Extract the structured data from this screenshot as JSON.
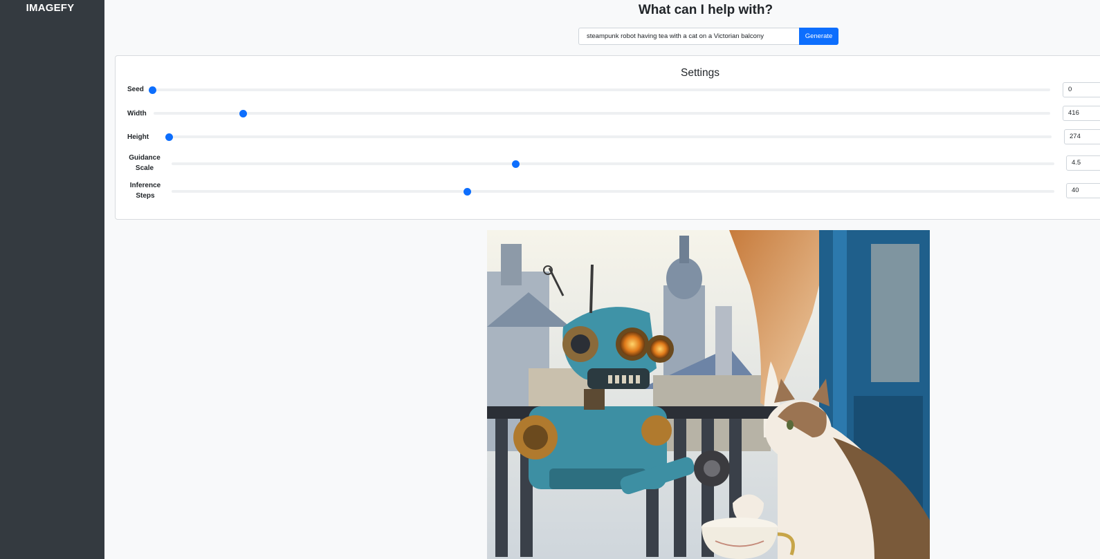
{
  "app": {
    "brand": "IMAGEFY"
  },
  "header": {
    "title": "What can I help with?"
  },
  "prompt": {
    "value": "steampunk robot having tea with a cat on a Victorian balcony",
    "button_label": "Generate"
  },
  "settings": {
    "title": "Settings",
    "sliders": [
      {
        "id": "seed",
        "label": "Seed",
        "value": "0",
        "fill": 0.0
      },
      {
        "id": "width",
        "label": "Width",
        "value": "416",
        "fill": 0.1
      },
      {
        "id": "height",
        "label": "Height",
        "value": "274",
        "fill": 0.0
      },
      {
        "id": "guidance",
        "label": "Guidance Scale",
        "label_lines": [
          "Guidance",
          "Scale"
        ],
        "value": "4.5",
        "fill": 0.39
      },
      {
        "id": "steps",
        "label": "Inference Steps",
        "label_lines": [
          "Inference",
          "Steps"
        ],
        "value": "40",
        "fill": 0.335
      }
    ]
  },
  "result": {
    "icon": "generated-image",
    "palette": {
      "sky": "#e9ecef",
      "robot": "#3d8fa3",
      "brass": "#b07a2e",
      "door": "#1f5f8b",
      "curtain": "#c98a4a",
      "cat_light": "#f3ece2",
      "cat_dark": "#7a5a3a"
    }
  },
  "colors": {
    "accent": "#0d6efd",
    "sidebar": "#343a40",
    "background": "#f8f9fa"
  }
}
